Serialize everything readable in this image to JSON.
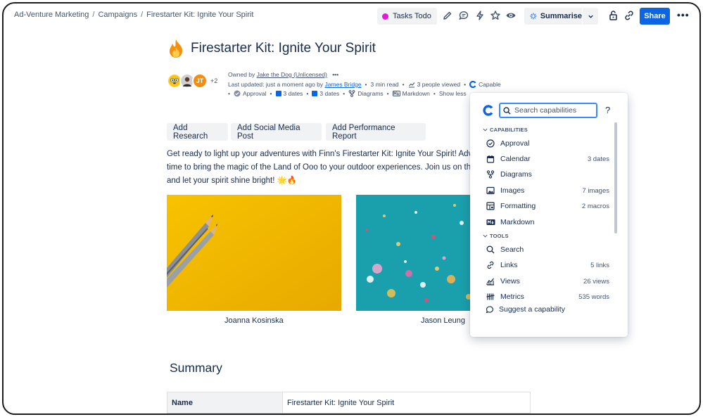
{
  "breadcrumbs": [
    "Ad-Venture Marketing",
    "Campaigns",
    "Firestarter Kit: Ignite Your Spirit"
  ],
  "header": {
    "tasks_label": "Tasks Todo",
    "summarise_label": "Summarise",
    "share_label": "Share",
    "more_label": "•••"
  },
  "page": {
    "title": "Firestarter Kit: Ignite Your Spirit",
    "avatars_extra": "+2",
    "avatar_initials": "JT",
    "owned_prefix": "Owned by",
    "owner": "Jake the Dog (Unlicensed)",
    "owner_more": "•••",
    "updated_prefix": "Last updated: just a moment ago by",
    "updated_by": "James Bridge",
    "read_time": "3 min read",
    "viewed": "3 people viewed",
    "capable": "Capable",
    "approval": "Approval",
    "dates1": "3 dates",
    "dates2": "3 dates",
    "diagrams": "Diagrams",
    "markdown": "Markdown",
    "show_less": "Show less"
  },
  "actions": [
    "Add Research",
    "Add Social Media Post",
    "Add Performance Report"
  ],
  "body_text": {
    "line1": "Get ready to light up your adventures with Finn's Firestarter Kit: Ignite Your Spirit! Advent",
    "line2": "time to bring the magic of the Land of Ooo to your outdoor experiences. Join us on this e",
    "line3": "and let your spirit shine bright! 🌟🔥"
  },
  "images": [
    {
      "caption": "Joanna Kosinska"
    },
    {
      "caption": "Jason Leung"
    }
  ],
  "summary": {
    "heading": "Summary",
    "row_label": "Name",
    "row_value": "Firestarter Kit: Ignite Your Spirit"
  },
  "popup": {
    "search_placeholder": "Search capabilities",
    "help": "?",
    "capabilities_header": "CAPABILITIES",
    "tools_header": "TOOLS",
    "capabilities": [
      {
        "label": "Approval",
        "value": "",
        "icon": "check-circle-icon"
      },
      {
        "label": "Calendar",
        "value": "3 dates",
        "icon": "calendar-icon"
      },
      {
        "label": "Diagrams",
        "value": "",
        "icon": "diagram-icon"
      },
      {
        "label": "Images",
        "value": "7 images",
        "icon": "image-icon"
      },
      {
        "label": "Formatting",
        "value": "2 macros",
        "icon": "formatting-icon"
      },
      {
        "label": "Markdown",
        "value": "",
        "icon": "markdown-icon"
      }
    ],
    "tools": [
      {
        "label": "Search",
        "value": "",
        "icon": "search-icon"
      },
      {
        "label": "Links",
        "value": "5 links",
        "icon": "link-icon"
      },
      {
        "label": "Views",
        "value": "26 views",
        "icon": "chart-icon"
      },
      {
        "label": "Metrics",
        "value": "535 words",
        "icon": "metrics-icon"
      }
    ],
    "suggest": "Suggest a capability"
  },
  "colors": {
    "primary": "#0c66e4",
    "tasks_dot": "#e419d6",
    "image1_bg": "#f3bd00",
    "image2_bg": "#1aa0ac"
  }
}
